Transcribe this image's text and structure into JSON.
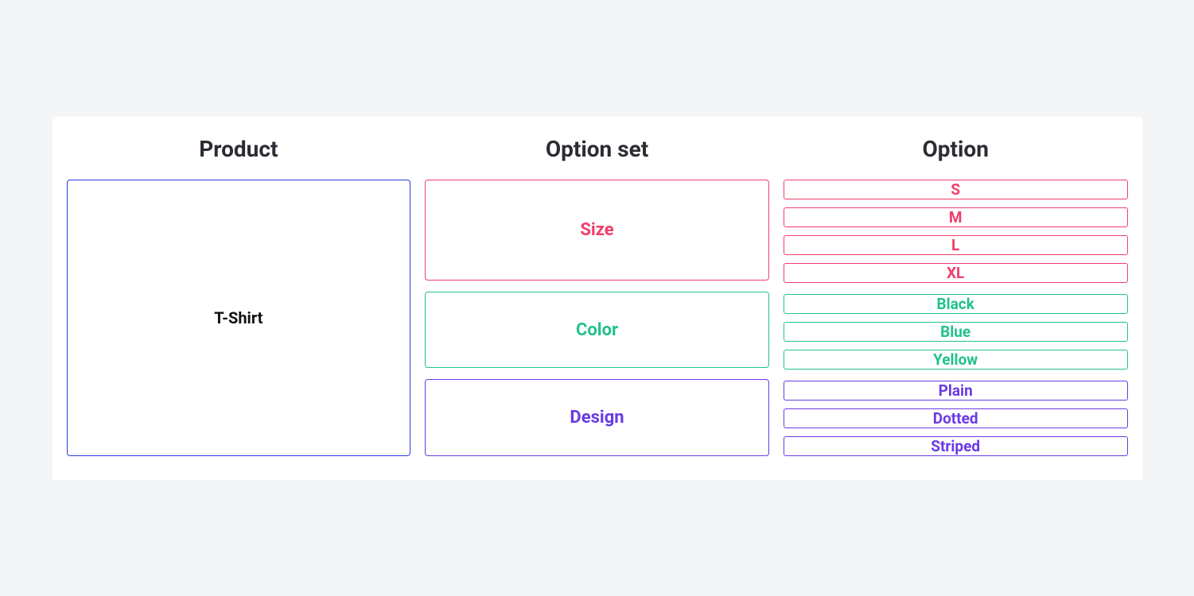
{
  "headers": {
    "product": "Product",
    "optionset": "Option set",
    "option": "Option"
  },
  "product": {
    "name": "T-Shirt",
    "color": "#2a3ae4"
  },
  "optionSets": [
    {
      "name": "Size",
      "color": "#f03e6a",
      "options": [
        "S",
        "M",
        "L",
        "XL"
      ]
    },
    {
      "name": "Color",
      "color": "#22c28b",
      "options": [
        "Black",
        "Blue",
        "Yellow"
      ]
    },
    {
      "name": "Design",
      "color": "#6a3ae4",
      "options": [
        "Plain",
        "Dotted",
        "Striped"
      ]
    }
  ]
}
